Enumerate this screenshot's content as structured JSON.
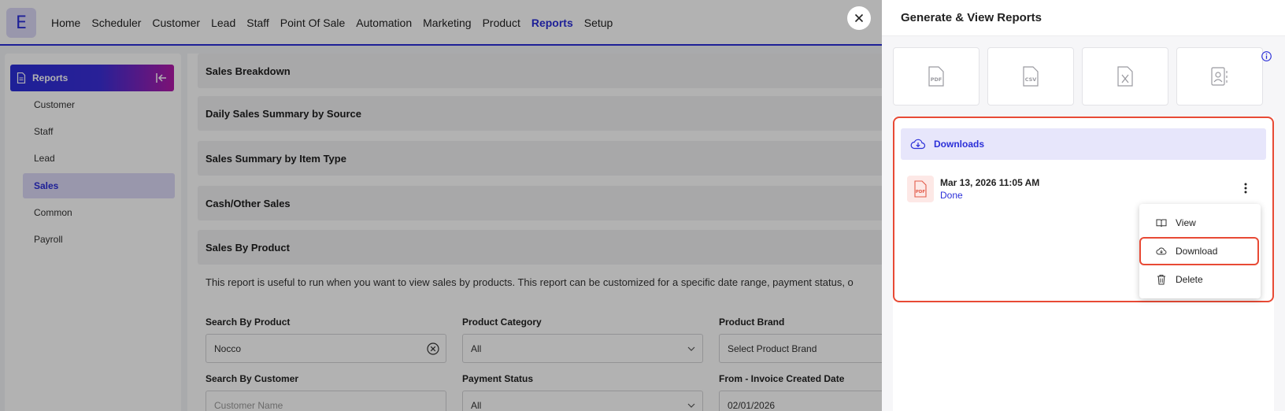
{
  "app": {
    "logo_letter": "E",
    "nav": [
      "Home",
      "Scheduler",
      "Customer",
      "Lead",
      "Staff",
      "Point Of Sale",
      "Automation",
      "Marketing",
      "Product",
      "Reports",
      "Setup"
    ],
    "active_nav": "Reports"
  },
  "sidebar": {
    "title": "Reports",
    "items": [
      "Customer",
      "Staff",
      "Lead",
      "Sales",
      "Common",
      "Payroll"
    ],
    "active": "Sales"
  },
  "main": {
    "sections": [
      "Sales Breakdown",
      "Daily Sales Summary by Source",
      "Sales Summary by Item Type",
      "Cash/Other Sales",
      "Sales By Product"
    ],
    "description": "This report is useful to run when you want to view sales by products. This report can be customized for a specific date range, payment status, o",
    "filters": {
      "search_by_product": {
        "label": "Search By Product",
        "value": "Nocco"
      },
      "product_category": {
        "label": "Product Category",
        "value": "All"
      },
      "product_brand": {
        "label": "Product Brand",
        "value": "Select Product Brand"
      },
      "search_by_customer": {
        "label": "Search By Customer",
        "placeholder": "Customer Name"
      },
      "payment_status": {
        "label": "Payment Status",
        "value": "All"
      },
      "invoice_from": {
        "label": "From - Invoice Created Date",
        "value": "02/01/2026"
      }
    }
  },
  "drawer": {
    "title": "Generate & View Reports",
    "formats": [
      "pdf-icon",
      "csv-icon",
      "excel-icon",
      "contact-report-icon"
    ],
    "downloads_label": "Downloads",
    "file": {
      "date": "Mar 13, 2026 11:05 AM",
      "status": "Done"
    },
    "menu": [
      "View",
      "Download",
      "Delete"
    ]
  },
  "colors": {
    "accent": "#2b2fd8",
    "highlight": "#e84a35"
  }
}
